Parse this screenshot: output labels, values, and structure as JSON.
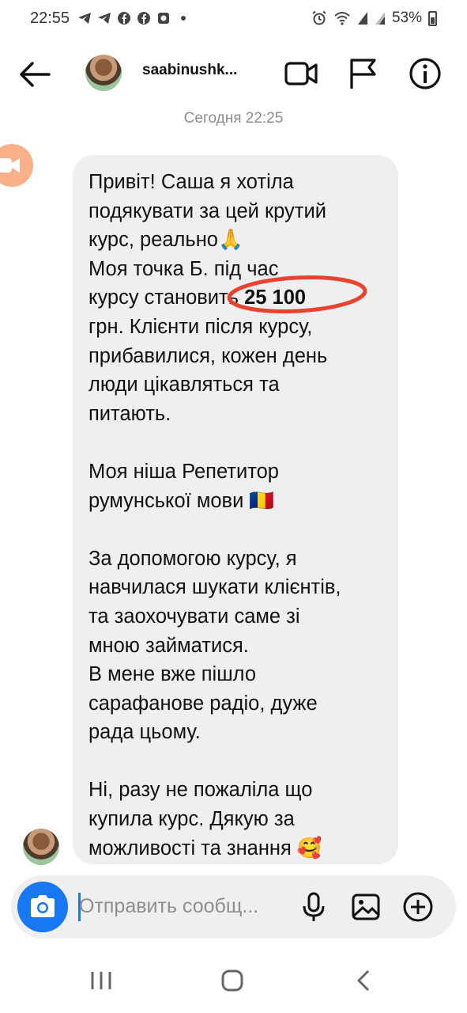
{
  "status_bar": {
    "time": "22:55",
    "battery": "53%",
    "left_icons": [
      "telegram-icon",
      "telegram-icon",
      "facebook-icon",
      "facebook-icon",
      "messenger-icon",
      "dot-icon"
    ],
    "right_icons": [
      "alarm-icon",
      "wifi-icon",
      "signal-icon",
      "signal-icon",
      "battery-icon"
    ]
  },
  "header": {
    "username": "saabinushk...",
    "actions": [
      "video-call-icon",
      "flag-icon",
      "info-icon"
    ]
  },
  "thread": {
    "date_label": "Сегодня 22:25",
    "message": {
      "p1_l1": "Привіт! Саша я хотіла",
      "p1_l2": "подякувати за цей крутий",
      "p1_l3": "курс, реально🙏",
      "p1_l4": "Моя точка Б. під час",
      "p1_l5_before": "курсу становить ",
      "p1_l5_bold": "25 100",
      "p1_l6": "грн. Клієнти після курсу,",
      "p1_l7": "прибавилися, кожен день",
      "p1_l8": "люди цікавляться та",
      "p1_l9": "питають.",
      "p2_l1": "Моя ніша Репетитор",
      "p2_l2": "румунської мови 🇷🇴",
      "p3_l1": "За допомогою курсу, я",
      "p3_l2": "навчилася шукати клієнтів,",
      "p3_l3": "та заохочувати саме зі",
      "p3_l4": "мною займатися.",
      "p3_l5": "В мене вже пішло",
      "p3_l6": "сарафанове радіо, дуже",
      "p3_l7": "рада цьому.",
      "p4_l1": "Ні, разу не пожаліла що",
      "p4_l2": "купила курс. Дякую за",
      "p4_l3": "можливості та знання 🥰"
    },
    "highlight_color": "#e8432e"
  },
  "composer": {
    "placeholder": "Отправить сообщ...",
    "accent": "#1877f2",
    "actions": [
      "microphone-icon",
      "gallery-icon",
      "add-icon"
    ]
  },
  "nav": [
    "recents-icon",
    "home-icon",
    "back-icon"
  ]
}
